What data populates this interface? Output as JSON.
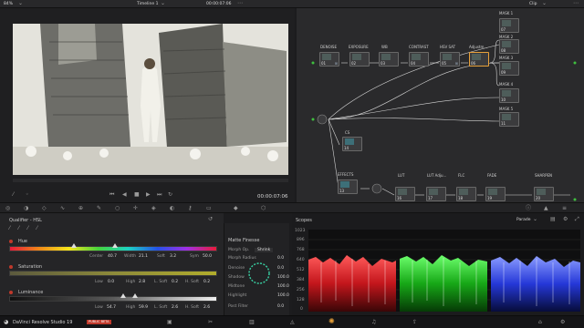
{
  "topbar": {
    "zoom": "84%",
    "timeline": "Timeline 1",
    "timecode": "00:00:07:06",
    "mode": "Clip"
  },
  "viewer": {
    "timecode": "00:00:07:06"
  },
  "nodes": {
    "serial": [
      {
        "label": "DENOISE",
        "num": "01"
      },
      {
        "label": "EXPOSURE",
        "num": "02"
      },
      {
        "label": "WB",
        "num": "03"
      },
      {
        "label": "CONTRAST",
        "num": "04"
      },
      {
        "label": "HSV SAT",
        "num": "05"
      },
      {
        "label": "Adjustm...",
        "num": "06"
      }
    ],
    "masks": [
      {
        "label": "MASK 1",
        "num": "07"
      },
      {
        "label": "MASK 2",
        "num": "08"
      },
      {
        "label": "MASK 3",
        "num": "09"
      },
      {
        "label": "MASK 4",
        "num": "10"
      },
      {
        "label": "MASK 5",
        "num": "11"
      }
    ],
    "cs": {
      "label": "CS",
      "num": "14"
    },
    "effects": {
      "label": "EFFECTS",
      "num": "13"
    },
    "lower": [
      {
        "label": "LUT",
        "num": "16"
      },
      {
        "label": "LUT Adju...",
        "num": "17"
      },
      {
        "label": "FLC",
        "num": "18"
      },
      {
        "label": "FADE",
        "num": "19"
      },
      {
        "label": "SHARPEN",
        "num": "20"
      }
    ]
  },
  "qualifier": {
    "title": "Qualifier - HSL",
    "hue": {
      "label": "Hue",
      "row": [
        {
          "k": "Center",
          "v": "40.7"
        },
        {
          "k": "Width",
          "v": "21.1"
        },
        {
          "k": "Soft",
          "v": "3.2"
        },
        {
          "k": "Sym",
          "v": "50.0"
        }
      ]
    },
    "saturation": {
      "label": "Saturation",
      "row": [
        {
          "k": "Low",
          "v": "0.0"
        },
        {
          "k": "High",
          "v": "2.8"
        },
        {
          "k": "L. Soft",
          "v": "0.2"
        },
        {
          "k": "H. Soft",
          "v": "0.2"
        }
      ]
    },
    "luminance": {
      "label": "Luminance",
      "row": [
        {
          "k": "Low",
          "v": "54.7"
        },
        {
          "k": "High",
          "v": "59.9"
        },
        {
          "k": "L. Soft",
          "v": "2.6"
        },
        {
          "k": "H. Soft",
          "v": "2.6"
        }
      ]
    }
  },
  "matte": {
    "title": "Matte Finesse",
    "morph_label": "Morph Op.",
    "morph_value": "Shrink",
    "rows": [
      {
        "k": "Morph Radius",
        "v": "0.0"
      },
      {
        "k": "Denoise",
        "v": "0.0"
      },
      {
        "k": "Shadow",
        "v": "100.0"
      },
      {
        "k": "Midtone",
        "v": "100.0"
      },
      {
        "k": "Highlight",
        "v": "100.0"
      },
      {
        "k": "Post Filter",
        "v": "0.0"
      }
    ]
  },
  "scopes": {
    "title": "Scopes",
    "mode": "Parade",
    "ticks": [
      "1023",
      "896",
      "768",
      "640",
      "512",
      "384",
      "256",
      "128",
      "0"
    ]
  },
  "bottom": {
    "app": "DaVinci Resolve Studio 19",
    "badge": "PUBLIC BETA"
  },
  "colors": {
    "accent": "#e8a13a",
    "badge": "#c0392b",
    "node_link": "#3fbf3f",
    "node_border_selected": "#e8a13a"
  }
}
